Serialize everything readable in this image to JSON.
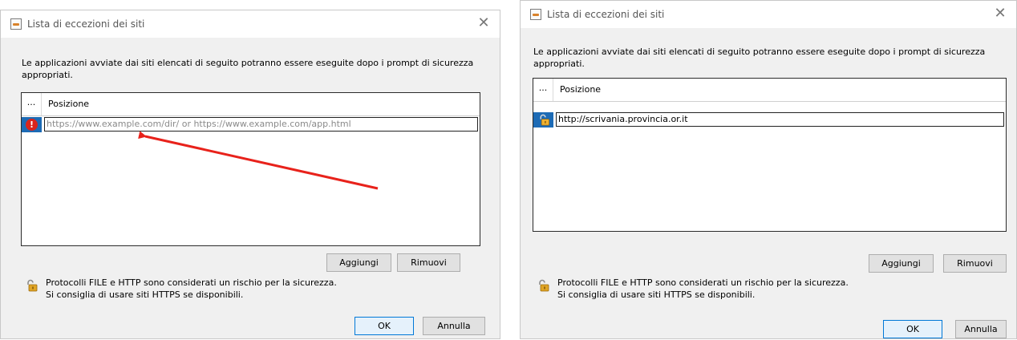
{
  "dialogs": [
    {
      "title": "Lista di eccezioni dei siti",
      "close_glyph": "✕",
      "description": "Le applicazioni avviate dai siti elencati di seguito potranno essere eseguite dopo i prompt di sicurezza appropriati.",
      "table": {
        "col_dots": "...",
        "col_position": "Posizione",
        "row_icon": "error-icon",
        "row_icon_glyph": "!",
        "row_placeholder": "https://www.example.com/dir/ or https://www.example.com/app.html"
      },
      "add_label": "Aggiungi",
      "remove_label": "Rimuovi",
      "warning_line1": "Protocolli FILE e HTTP sono considerati un rischio per la sicurezza.",
      "warning_line2": "Si consiglia di usare siti HTTPS se disponibili.",
      "ok_label": "OK",
      "cancel_label": "Annulla"
    },
    {
      "title": "Lista di eccezioni dei siti",
      "close_glyph": "✕",
      "description": "Le applicazioni avviate dai siti elencati di seguito potranno essere eseguite dopo i prompt di sicurezza appropriati.",
      "table": {
        "col_dots": "...",
        "col_position": "Posizione",
        "row_icon": "unlocked-padlock-icon",
        "row_value": "http://scrivania.provincia.or.it"
      },
      "add_label": "Aggiungi",
      "remove_label": "Rimuovi",
      "warning_line1": "Protocolli FILE e HTTP sono considerati un rischio per la sicurezza.",
      "warning_line2": "Si consiglia di usare siti HTTPS se disponibili.",
      "ok_label": "OK",
      "cancel_label": "Annulla"
    }
  ],
  "annotation": {
    "arrow_color": "#e8221b"
  },
  "colors": {
    "selection_blue": "#1d6bb5",
    "error_red": "#d9241c",
    "default_button_border": "#0078d7"
  }
}
